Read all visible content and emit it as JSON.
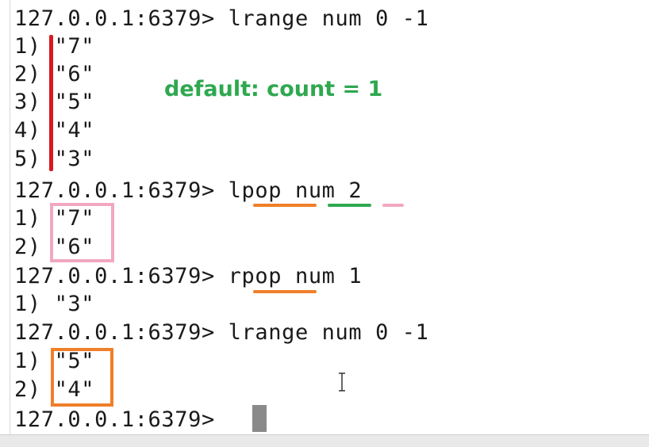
{
  "terminal": {
    "lines": [
      "127.0.0.1:6379> lrange num 0 -1",
      "1) \"7\"",
      "2) \"6\"",
      "3) \"5\"",
      "4) \"4\"",
      "5) \"3\"",
      "127.0.0.1:6379> lpop num 2",
      "1) \"7\"",
      "2) \"6\"",
      "127.0.0.1:6379> rpop num 1",
      "1) \"3\"",
      "127.0.0.1:6379> lrange num 0 -1",
      "1) \"5\"",
      "2) \"4\"",
      "127.0.0.1:6379> "
    ]
  },
  "annotations": {
    "note": "default: count = 1",
    "colors": {
      "red": "#d9191f",
      "orange": "#f07f2a",
      "green": "#2fa84f",
      "pink": "#f2a7c0"
    }
  },
  "icons": {
    "cursor": "block-cursor-icon",
    "mouse": "text-ibeam-icon"
  }
}
